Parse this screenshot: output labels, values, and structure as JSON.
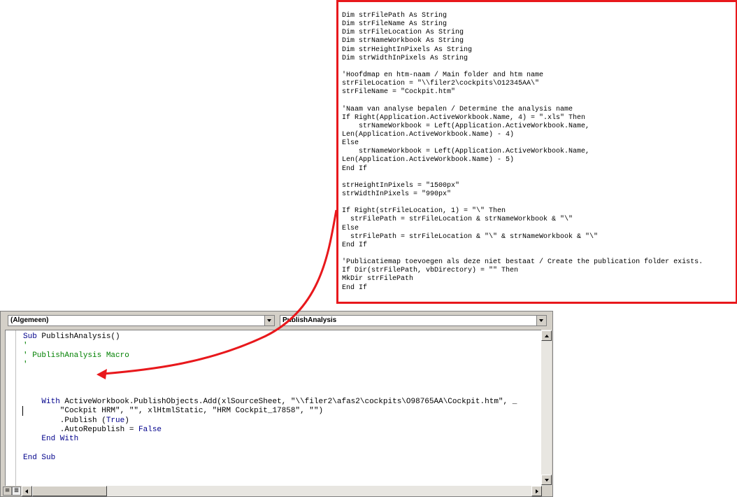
{
  "callout": {
    "border_color": "#e8181c",
    "lines": [
      "Dim strFilePath As String",
      "Dim strFileName As String",
      "Dim strFileLocation As String",
      "Dim strNameWorkbook As String",
      "Dim strHeightInPixels As String",
      "Dim strWidthInPixels As String",
      "",
      "'Hoofdmap en htm-naam / Main folder and htm name",
      "strFileLocation = \"\\\\filer2\\cockpits\\O12345AA\\\"",
      "strFileName = \"Cockpit.htm\"",
      "",
      "'Naam van analyse bepalen / Determine the analysis name",
      "If Right(Application.ActiveWorkbook.Name, 4) = \".xls\" Then",
      "    strNameWorkbook = Left(Application.ActiveWorkbook.Name,",
      "Len(Application.ActiveWorkbook.Name) - 4)",
      "Else",
      "    strNameWorkbook = Left(Application.ActiveWorkbook.Name,",
      "Len(Application.ActiveWorkbook.Name) - 5)",
      "End If",
      "",
      "strHeightInPixels = \"1500px\"",
      "strWidthInPixels = \"990px\"",
      "",
      "If Right(strFileLocation, 1) = \"\\\" Then",
      "  strFilePath = strFileLocation & strNameWorkbook & \"\\\"",
      "Else",
      "  strFilePath = strFileLocation & \"\\\" & strNameWorkbook & \"\\\"",
      "End If",
      "",
      "'Publicatiemap toevoegen als deze niet bestaat / Create the publication folder exists.",
      "If Dir(strFilePath, vbDirectory) = \"\" Then",
      "MkDir strFilePath",
      "End If"
    ]
  },
  "editor": {
    "object_combo": "(Algemeen)",
    "procedure_combo": "PublishAnalysis",
    "keyword_color": "#00008b",
    "comment_color": "#008000",
    "code": {
      "l1_kw": "Sub",
      "l1_rest": " PublishAnalysis()",
      "l2": "'",
      "l3": "' PublishAnalysis Macro",
      "l4": "'",
      "l8_kw": "    With",
      "l8_rest": " ActiveWorkbook.PublishObjects.Add(xlSourceSheet, \"\\\\filer2\\afas2\\cockpits\\O98765AA\\Cockpit.htm\", _",
      "l9": "        \"Cockpit HRM\", \"\", xlHtmlStatic, \"HRM Cockpit_17858\", \"\")",
      "l10_a": "        .Publish (",
      "l10_kw": "True",
      "l10_b": ")",
      "l11_a": "        .AutoRepublish = ",
      "l11_kw": "False",
      "l12_kw": "    End With",
      "l14_kw": "End Sub"
    }
  },
  "arrow": {
    "color": "#e8181c"
  }
}
